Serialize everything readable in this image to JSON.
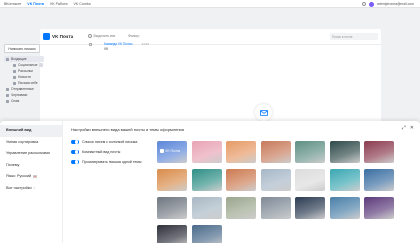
{
  "topbar": {
    "links": [
      "ВКонтакте",
      "VK Почта",
      "VK Работа",
      "VK Combo"
    ],
    "active_link": 1,
    "user_email": "artemjdronea@mail.com",
    "accent": "#0077ff"
  },
  "mail": {
    "logo_text": "VK Почта",
    "header_tabs": [
      "Выделить все",
      "Фильтр"
    ],
    "search_placeholder": "Поиск в почте",
    "compose_label": "Написать письмо",
    "folders": [
      {
        "label": "Входящие",
        "active": true,
        "sub": false,
        "icon": "inbox-icon"
      },
      {
        "label": "Социальные",
        "sub": true,
        "icon": "social-icon",
        "count": true
      },
      {
        "label": "Рассылки",
        "sub": true,
        "icon": "newsletter-icon"
      },
      {
        "label": "Новости",
        "sub": true,
        "icon": "news-icon"
      },
      {
        "label": "Письма себе",
        "sub": true,
        "icon": "self-mail-icon"
      },
      {
        "label": "Отправленные",
        "sub": false,
        "icon": "sent-icon"
      },
      {
        "label": "Черновики",
        "sub": false,
        "icon": "drafts-icon"
      },
      {
        "label": "Спам",
        "sub": false,
        "icon": "spam-icon"
      }
    ],
    "message": {
      "from": "Команда VK Почты",
      "subject": "VK",
      "time": "14:52"
    }
  },
  "panel": {
    "nav": [
      {
        "label": "Внешний вид",
        "active": true
      },
      {
        "label": "Умная сортировка"
      },
      {
        "label": "Управление рассылками"
      },
      {
        "label": "Почему"
      },
      {
        "label": "Язык: Русский",
        "flag": true
      },
      {
        "label": "Все настройки",
        "chevron": true
      }
    ],
    "title": "Настройки внешнего вида вашей почты и темы оформления",
    "toggles": [
      {
        "label": "Список писем с колонкой письма",
        "on": true
      },
      {
        "label": "Компактный вид почты",
        "on": true
      },
      {
        "label": "Просматривать письма одной темы",
        "on": true
      }
    ],
    "theme_first_label": "VK Почта",
    "theme_colors": [
      "#5b86d9",
      "#e8a3b4",
      "#e69a66",
      "#c77a5a",
      "#5e8f83",
      "#2f4a4a",
      "#8a3b4f",
      "#d98c4a",
      "#2f8f86",
      "#cc7a50",
      "#a6b7c7",
      "#dcdcdc",
      "#3aa7b2",
      "#3a6ea1",
      "#6f7680",
      "#a8b8c4",
      "#9aa58d",
      "#7f8a96",
      "#2b3b52",
      "#4a7fa8",
      "#5b3a7a",
      "#2d2f3a",
      "#4a6a8a"
    ],
    "close_glyphs": [
      "⤢",
      "✕"
    ]
  }
}
